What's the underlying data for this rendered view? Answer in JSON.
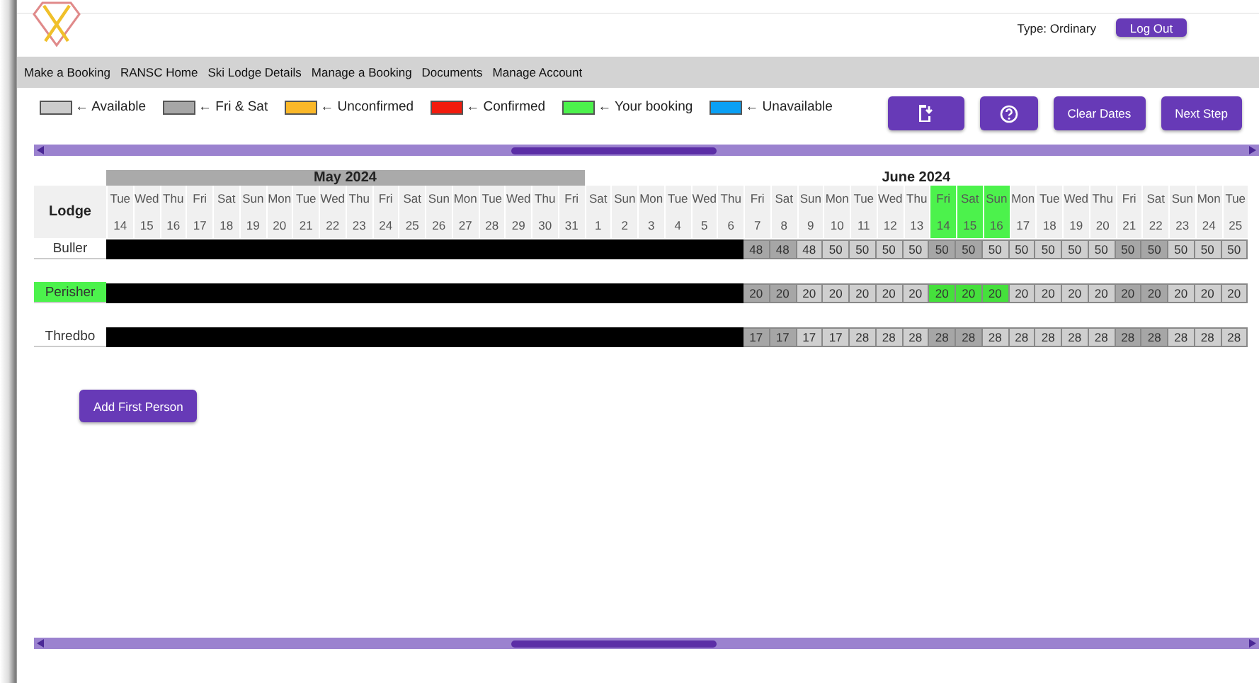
{
  "header": {
    "account_type": "Type: Ordinary",
    "logout": "Log Out"
  },
  "nav": [
    "Make a Booking",
    "RANSC Home",
    "Ski Lodge Details",
    "Manage a Booking",
    "Documents",
    "Manage Account"
  ],
  "legend": [
    {
      "label": "← Available",
      "color": "#cccccc"
    },
    {
      "label": "← Fri & Sat",
      "color": "#a6a6a6"
    },
    {
      "label": "← Unconfirmed",
      "color": "#fbb829"
    },
    {
      "label": "←  Confirmed",
      "color": "#f21b0d"
    },
    {
      "label": "← Your booking",
      "color": "#4cf24c"
    },
    {
      "label": "← Unavailable",
      "color": "#0aa0f5"
    }
  ],
  "toolbar": [
    {
      "kind": "download"
    },
    {
      "kind": "help"
    },
    {
      "kind": "text",
      "label": "Clear Dates"
    },
    {
      "kind": "text",
      "label": "Next Step"
    }
  ],
  "table": {
    "lodge_heading": "Lodge",
    "months": [
      {
        "label": "May 2024",
        "shaded": true,
        "days": [
          {
            "dow": "Tue",
            "date": "14",
            "selected": false
          },
          {
            "dow": "Wed",
            "date": "15",
            "selected": false
          },
          {
            "dow": "Thu",
            "date": "16",
            "selected": false
          },
          {
            "dow": "Fri",
            "date": "17",
            "selected": false
          },
          {
            "dow": "Sat",
            "date": "18",
            "selected": false
          },
          {
            "dow": "Sun",
            "date": "19",
            "selected": false
          },
          {
            "dow": "Mon",
            "date": "20",
            "selected": false
          },
          {
            "dow": "Tue",
            "date": "21",
            "selected": false
          },
          {
            "dow": "Wed",
            "date": "22",
            "selected": false
          },
          {
            "dow": "Thu",
            "date": "23",
            "selected": false
          },
          {
            "dow": "Fri",
            "date": "24",
            "selected": false
          },
          {
            "dow": "Sat",
            "date": "25",
            "selected": false
          },
          {
            "dow": "Sun",
            "date": "26",
            "selected": false
          },
          {
            "dow": "Mon",
            "date": "27",
            "selected": false
          },
          {
            "dow": "Tue",
            "date": "28",
            "selected": false
          },
          {
            "dow": "Wed",
            "date": "29",
            "selected": false
          },
          {
            "dow": "Thu",
            "date": "30",
            "selected": false
          },
          {
            "dow": "Fri",
            "date": "31",
            "selected": false
          }
        ]
      },
      {
        "label": "June 2024",
        "shaded": false,
        "days": [
          {
            "dow": "Sat",
            "date": "1",
            "selected": false
          },
          {
            "dow": "Sun",
            "date": "2",
            "selected": false
          },
          {
            "dow": "Mon",
            "date": "3",
            "selected": false
          },
          {
            "dow": "Tue",
            "date": "4",
            "selected": false
          },
          {
            "dow": "Wed",
            "date": "5",
            "selected": false
          },
          {
            "dow": "Thu",
            "date": "6",
            "selected": false
          },
          {
            "dow": "Fri",
            "date": "7",
            "selected": false
          },
          {
            "dow": "Sat",
            "date": "8",
            "selected": false
          },
          {
            "dow": "Sun",
            "date": "9",
            "selected": false
          },
          {
            "dow": "Mon",
            "date": "10",
            "selected": false
          },
          {
            "dow": "Tue",
            "date": "11",
            "selected": false
          },
          {
            "dow": "Wed",
            "date": "12",
            "selected": false
          },
          {
            "dow": "Thu",
            "date": "13",
            "selected": false
          },
          {
            "dow": "Fri",
            "date": "14",
            "selected": true
          },
          {
            "dow": "Sat",
            "date": "15",
            "selected": true
          },
          {
            "dow": "Sun",
            "date": "16",
            "selected": true
          },
          {
            "dow": "Mon",
            "date": "17",
            "selected": false
          },
          {
            "dow": "Tue",
            "date": "18",
            "selected": false
          },
          {
            "dow": "Wed",
            "date": "19",
            "selected": false
          },
          {
            "dow": "Thu",
            "date": "20",
            "selected": false
          },
          {
            "dow": "Fri",
            "date": "21",
            "selected": false
          },
          {
            "dow": "Sat",
            "date": "22",
            "selected": false
          },
          {
            "dow": "Sun",
            "date": "23",
            "selected": false
          },
          {
            "dow": "Mon",
            "date": "24",
            "selected": false
          },
          {
            "dow": "Tue",
            "date": "25",
            "selected": false
          }
        ]
      }
    ],
    "lodges": [
      {
        "name": "Buller",
        "selected": false,
        "cells": [
          {
            "kind": "blocked"
          },
          {
            "kind": "blocked"
          },
          {
            "kind": "blocked"
          },
          {
            "kind": "blocked"
          },
          {
            "kind": "blocked"
          },
          {
            "kind": "blocked"
          },
          {
            "kind": "blocked"
          },
          {
            "kind": "blocked"
          },
          {
            "kind": "blocked"
          },
          {
            "kind": "blocked"
          },
          {
            "kind": "blocked"
          },
          {
            "kind": "blocked"
          },
          {
            "kind": "blocked"
          },
          {
            "kind": "blocked"
          },
          {
            "kind": "blocked"
          },
          {
            "kind": "blocked"
          },
          {
            "kind": "blocked"
          },
          {
            "kind": "blocked"
          },
          {
            "kind": "blocked"
          },
          {
            "kind": "blocked"
          },
          {
            "kind": "blocked"
          },
          {
            "kind": "blocked"
          },
          {
            "kind": "blocked"
          },
          {
            "kind": "blocked"
          },
          {
            "kind": "weekend",
            "text": "48"
          },
          {
            "kind": "weekend",
            "text": "48"
          },
          {
            "kind": "available",
            "text": "48"
          },
          {
            "kind": "available",
            "text": "50"
          },
          {
            "kind": "available",
            "text": "50"
          },
          {
            "kind": "available",
            "text": "50"
          },
          {
            "kind": "available",
            "text": "50"
          },
          {
            "kind": "weekend",
            "text": "50"
          },
          {
            "kind": "weekend",
            "text": "50"
          },
          {
            "kind": "available",
            "text": "50"
          },
          {
            "kind": "available",
            "text": "50"
          },
          {
            "kind": "available",
            "text": "50"
          },
          {
            "kind": "available",
            "text": "50"
          },
          {
            "kind": "available",
            "text": "50"
          },
          {
            "kind": "weekend",
            "text": "50"
          },
          {
            "kind": "weekend",
            "text": "50"
          },
          {
            "kind": "available",
            "text": "50"
          },
          {
            "kind": "available",
            "text": "50"
          },
          {
            "kind": "available",
            "text": "50"
          }
        ]
      },
      {
        "name": "Perisher",
        "selected": true,
        "cells": [
          {
            "kind": "blocked"
          },
          {
            "kind": "blocked"
          },
          {
            "kind": "blocked"
          },
          {
            "kind": "blocked"
          },
          {
            "kind": "blocked"
          },
          {
            "kind": "blocked"
          },
          {
            "kind": "blocked"
          },
          {
            "kind": "blocked"
          },
          {
            "kind": "blocked"
          },
          {
            "kind": "blocked"
          },
          {
            "kind": "blocked"
          },
          {
            "kind": "blocked"
          },
          {
            "kind": "blocked"
          },
          {
            "kind": "blocked"
          },
          {
            "kind": "blocked"
          },
          {
            "kind": "blocked"
          },
          {
            "kind": "blocked"
          },
          {
            "kind": "blocked"
          },
          {
            "kind": "blocked"
          },
          {
            "kind": "blocked"
          },
          {
            "kind": "blocked"
          },
          {
            "kind": "blocked"
          },
          {
            "kind": "blocked"
          },
          {
            "kind": "blocked"
          },
          {
            "kind": "weekend",
            "text": "20"
          },
          {
            "kind": "weekend",
            "text": "20"
          },
          {
            "kind": "available",
            "text": "20"
          },
          {
            "kind": "available",
            "text": "20"
          },
          {
            "kind": "available",
            "text": "20"
          },
          {
            "kind": "available",
            "text": "20"
          },
          {
            "kind": "available",
            "text": "20"
          },
          {
            "kind": "mine",
            "text": "20"
          },
          {
            "kind": "mine",
            "text": "20"
          },
          {
            "kind": "mine",
            "text": "20"
          },
          {
            "kind": "available",
            "text": "20"
          },
          {
            "kind": "available",
            "text": "20"
          },
          {
            "kind": "available",
            "text": "20"
          },
          {
            "kind": "available",
            "text": "20"
          },
          {
            "kind": "weekend",
            "text": "20"
          },
          {
            "kind": "weekend",
            "text": "20"
          },
          {
            "kind": "available",
            "text": "20"
          },
          {
            "kind": "available",
            "text": "20"
          },
          {
            "kind": "available",
            "text": "20"
          }
        ]
      },
      {
        "name": "Thredbo",
        "selected": false,
        "cells": [
          {
            "kind": "blocked"
          },
          {
            "kind": "blocked"
          },
          {
            "kind": "blocked"
          },
          {
            "kind": "blocked"
          },
          {
            "kind": "blocked"
          },
          {
            "kind": "blocked"
          },
          {
            "kind": "blocked"
          },
          {
            "kind": "blocked"
          },
          {
            "kind": "blocked"
          },
          {
            "kind": "blocked"
          },
          {
            "kind": "blocked"
          },
          {
            "kind": "blocked"
          },
          {
            "kind": "blocked"
          },
          {
            "kind": "blocked"
          },
          {
            "kind": "blocked"
          },
          {
            "kind": "blocked"
          },
          {
            "kind": "blocked"
          },
          {
            "kind": "blocked"
          },
          {
            "kind": "blocked"
          },
          {
            "kind": "blocked"
          },
          {
            "kind": "blocked"
          },
          {
            "kind": "blocked"
          },
          {
            "kind": "blocked"
          },
          {
            "kind": "blocked"
          },
          {
            "kind": "weekend",
            "text": "17"
          },
          {
            "kind": "weekend",
            "text": "17"
          },
          {
            "kind": "available",
            "text": "17"
          },
          {
            "kind": "available",
            "text": "17"
          },
          {
            "kind": "available",
            "text": "28"
          },
          {
            "kind": "available",
            "text": "28"
          },
          {
            "kind": "available",
            "text": "28"
          },
          {
            "kind": "weekend",
            "text": "28"
          },
          {
            "kind": "weekend",
            "text": "28"
          },
          {
            "kind": "available",
            "text": "28"
          },
          {
            "kind": "available",
            "text": "28"
          },
          {
            "kind": "available",
            "text": "28"
          },
          {
            "kind": "available",
            "text": "28"
          },
          {
            "kind": "available",
            "text": "28"
          },
          {
            "kind": "weekend",
            "text": "28"
          },
          {
            "kind": "weekend",
            "text": "28"
          },
          {
            "kind": "available",
            "text": "28"
          },
          {
            "kind": "available",
            "text": "28"
          },
          {
            "kind": "available",
            "text": "28"
          }
        ]
      }
    ]
  },
  "add_person": "Add First Person"
}
